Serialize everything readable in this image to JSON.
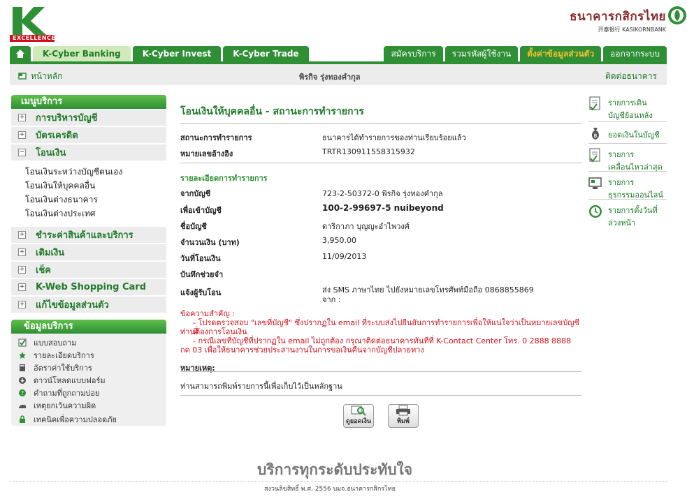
{
  "header": {
    "logo_text": "EXCELLENCE",
    "bank_name_th": "ธนาคารกสิกรไทย",
    "bank_name_en": "开泰银行 KASIKORNBANK"
  },
  "nav": {
    "tabs": [
      "K-Cyber Banking",
      "K-Cyber Invest",
      "K-Cyber Trade"
    ],
    "right": [
      "สมัครบริการ",
      "รวมรหัสผู้ใช้งาน",
      "ตั้งค่าข้อมูลส่วนตัว",
      "ออกจากระบบ"
    ]
  },
  "subbar": {
    "home": "หน้าหลัก",
    "user": "พิรกิจ รุ่งทองคำกุล",
    "contact": "ติดต่อธนาคาร"
  },
  "menu": {
    "title": "เมนูบริการ",
    "items": [
      "การบริหารบัญชี",
      "บัตรเครดิต",
      "โอนเงิน"
    ],
    "sub_items": [
      "โอนเงินระหว่างบัญชีตนเอง",
      "โอนเงินให้บุคคลอื่น",
      "โอนเงินต่างธนาคาร",
      "โอนเงินต่างประเทศ"
    ],
    "items2": [
      "ชำระค่าสินค้าและบริการ",
      "เติมเงิน",
      "เช็ค",
      "K-Web Shopping Card",
      "แก้ไขข้อมูลส่วนตัว"
    ]
  },
  "services": {
    "title": "ข้อมูลบริการ",
    "items": [
      "แบบสอบถาม",
      "รายละเอียดบริการ",
      "อัตราค่าใช้บริการ",
      "ดาวน์โหลดแบบฟอร์ม",
      "คำถามที่ถูกถามบ่อย",
      "เหตุยกเว้นความผิด",
      "เทคนิคเพื่อความปลอดภัย"
    ]
  },
  "content": {
    "title": "โอนเงินให้บุคคลอื่น - สถานะการทำรายการ",
    "status_label": "สถานะการทำรายการ",
    "status_value": "ธนาคารได้ทำรายการของท่านเรียบร้อยแล้ว",
    "ref_label": "หมายเลขอ้างอิง",
    "ref_value": "TRTR130911558315932",
    "detail_title": "รายละเอียดการทำรายการ",
    "from_label": "จากบัญชี",
    "from_value": "723-2-50372-0 พิรกิจ รุ่งทองคำกุล",
    "to_label": "เพื่อเข้าบัญชี",
    "to_value": "100-2-99697-5 nuibeyond",
    "name_label": "ชื่อบัญชี",
    "name_value": "ดาริกาภา บุญญะอำไพวงศ์",
    "amount_label": "จำนวนเงิน (บาท)",
    "amount_value": "3,950.00",
    "date_label": "วันที่โอนเงิน",
    "date_value": "11/09/2013",
    "memo_label": "บันทึกช่วยจำ",
    "notify_label": "แจ้งผู้รับโอน",
    "notify_value_1": "ส่ง SMS ภาษาไทย ไปยังหมายเลขโทรศัพท์มือถือ 0868855869",
    "notify_value_2": "จาก :",
    "important_title": "ข้อความสำคัญ :",
    "important_1": "- โปรดตรวจสอบ \"เลขที่บัญชี\" ซึ่งปรากฏใน email ที่ระบบส่งไปยืนยันการทำรายการเพื่อให้แน่ใจว่าเป็นหมายเลขบัญชีที่",
    "important_1b": "ท่านต้องการโอนเงิน",
    "important_2": "- กรณีเลขที่บัญชีที่ปรากฏใน email ไม่ถูกต้อง กรุณาติดต่อธนาคารทันทีที่ K-Contact Center โทร. 0 2888 8888",
    "important_2b": "กด 03 เพื่อให้ธนาคารช่วยประสานงานในการขอเงินคืนจากบัญชีปลายทาง",
    "note_title": "หมายเหตุ:",
    "note_text": "ท่านสามารถพิมพ์รายการนี้เพื่อเก็บไว้เป็นหลักฐาน",
    "btn_balance": "ดูยอดเงิน",
    "btn_print": "พิมพ์"
  },
  "right_panel": [
    [
      "รายการเดิน",
      "บัญชีย้อนหลัง"
    ],
    [
      "ยอดเงินในบัญชี"
    ],
    [
      "รายการ",
      "เคลื่อนไหวล่าสุด"
    ],
    [
      "รายการ",
      "ธุรกรรมออนไลน์"
    ],
    [
      "รายการตั้งวันที่",
      "ล่วงหน้า"
    ]
  ],
  "footer": {
    "slogan": "บริการทุกระดับประทับใจ",
    "copyright": "สงวนลิขสิทธิ์ พ.ศ. 2556 บมจ.ธนาคารกสิกรไทย"
  },
  "colors": {
    "primary_green": "#2e8f35",
    "light_green": "#cfe9b9",
    "alert_red": "#d0111b",
    "brand_red": "#8a2a2a"
  }
}
